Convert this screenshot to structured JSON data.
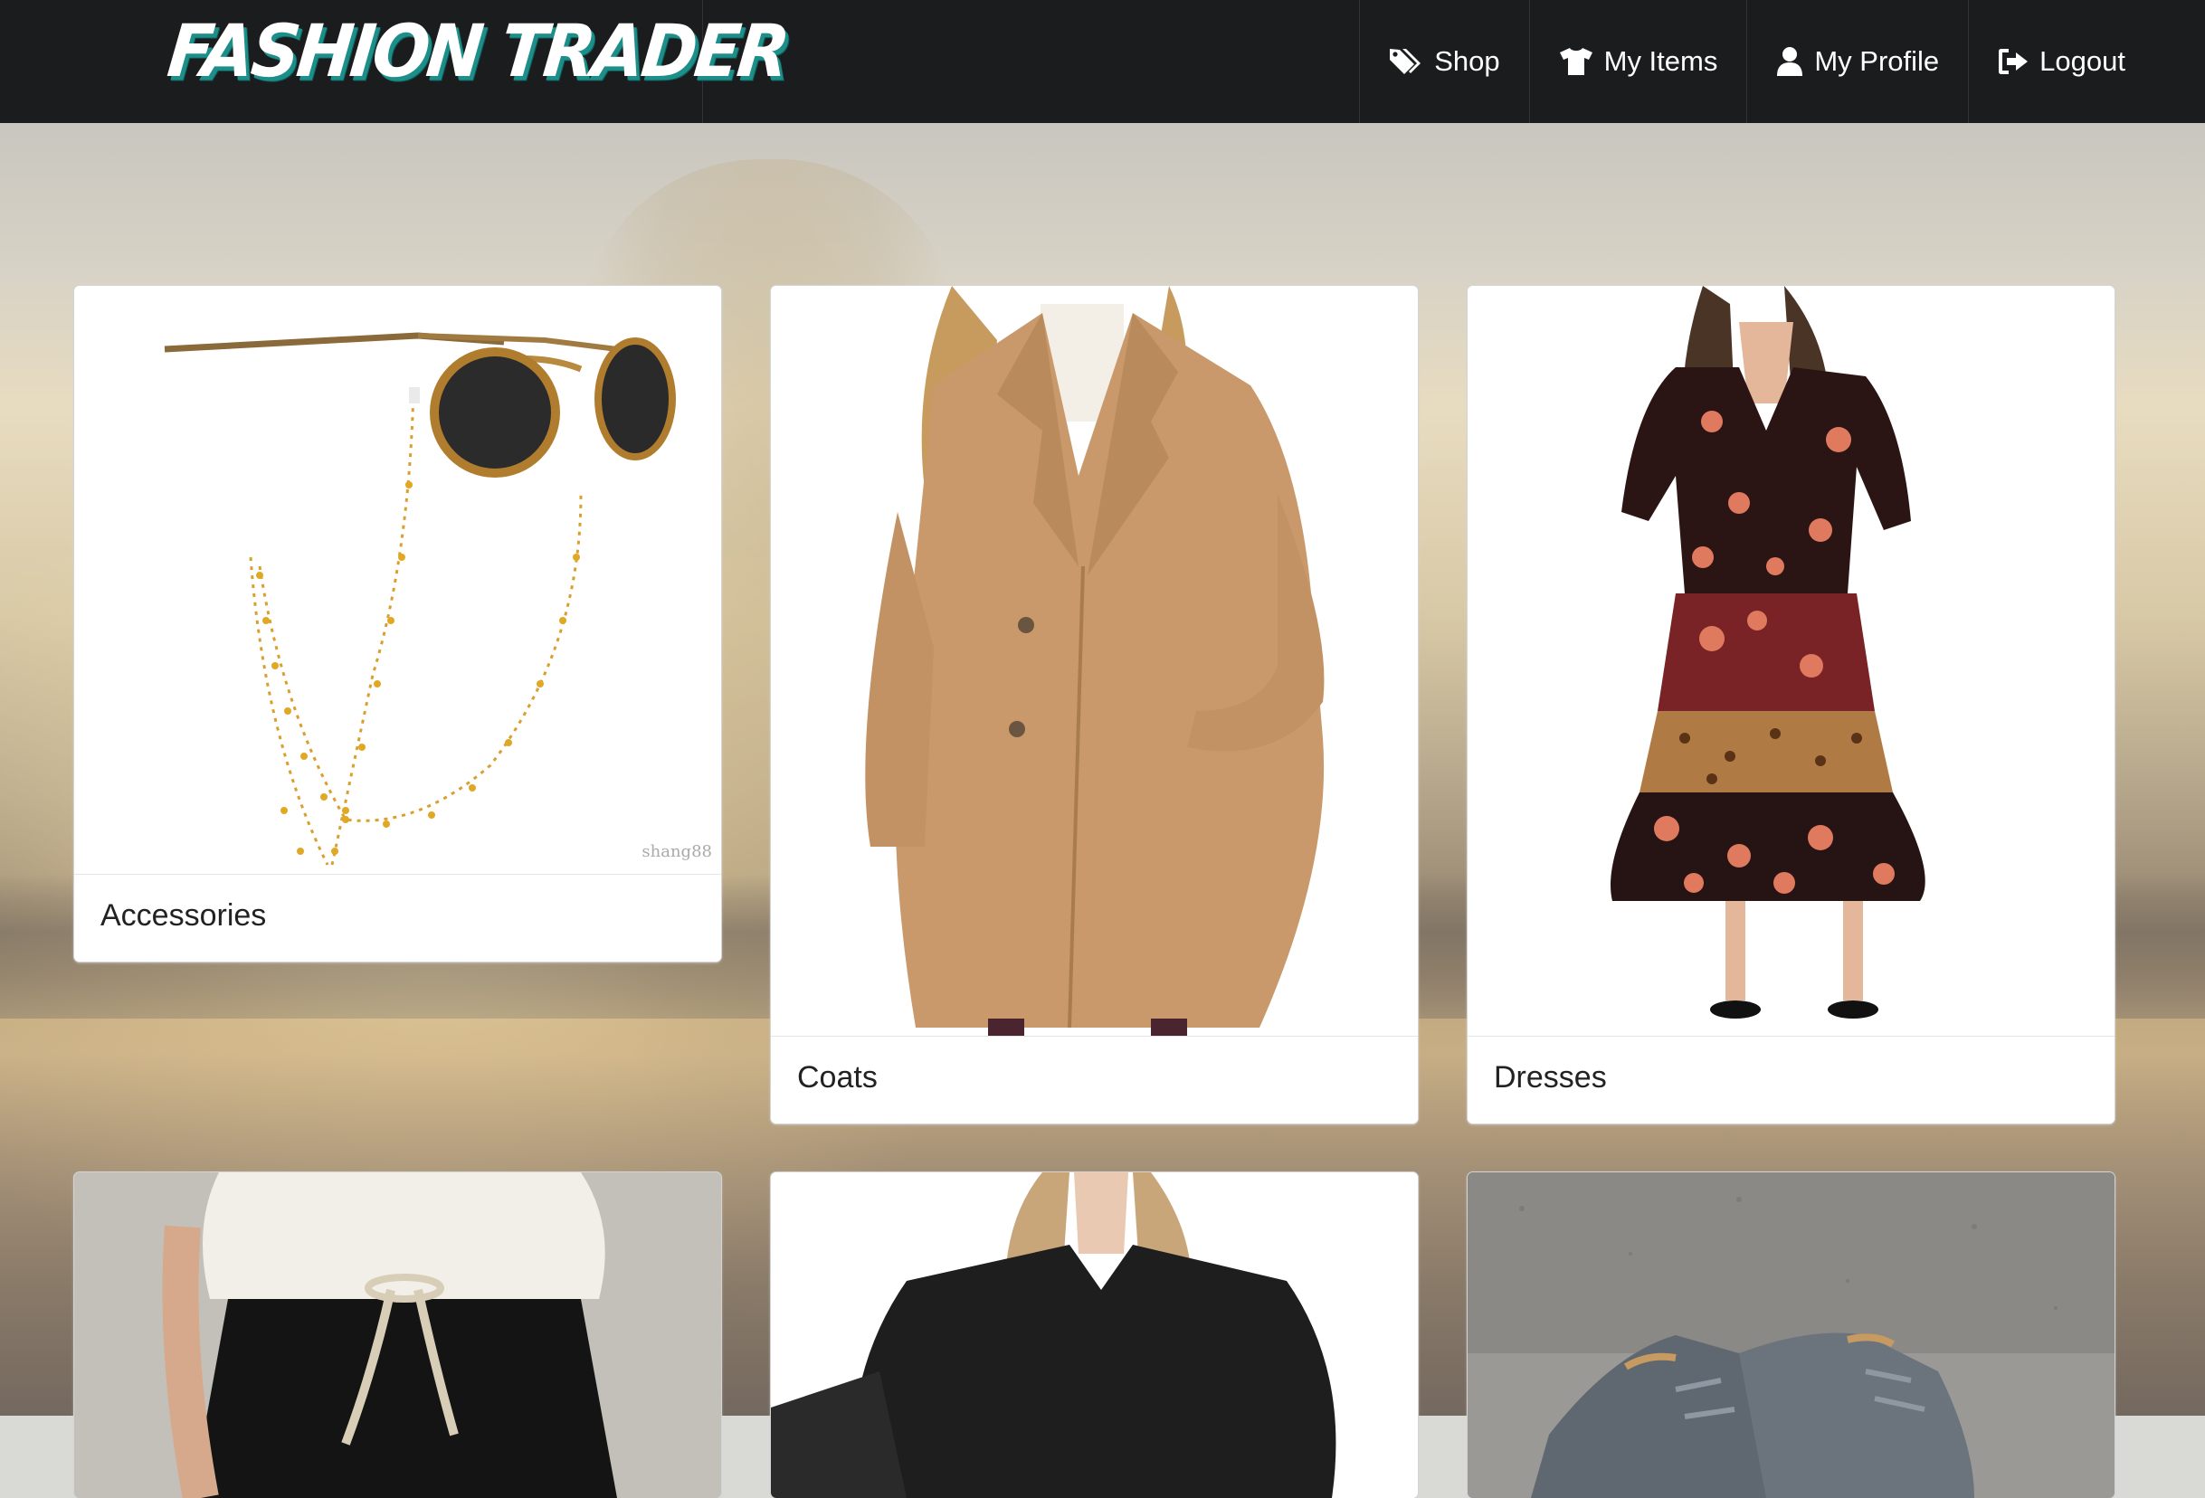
{
  "app": {
    "brand": "FASHION TRADER"
  },
  "nav": {
    "items": [
      {
        "label": "Shop",
        "icon": "tags-icon"
      },
      {
        "label": "My Items",
        "icon": "shirt-icon"
      },
      {
        "label": "My Profile",
        "icon": "user-icon"
      },
      {
        "label": "Logout",
        "icon": "sign-out-icon"
      }
    ]
  },
  "categories": [
    {
      "label": "Accessories",
      "image": "sunglasses-with-chain"
    },
    {
      "label": "Coats",
      "image": "camel-coat"
    },
    {
      "label": "Dresses",
      "image": "floral-dress"
    },
    {
      "label": "",
      "image": "joggers-and-sweatshirt"
    },
    {
      "label": "",
      "image": "black-blouse"
    },
    {
      "label": "",
      "image": "grey-sneakers"
    }
  ],
  "watermark": "shang88",
  "colors": {
    "navbar": "#1b1c1d",
    "brand_shadow": "#1d8f8a",
    "card": "#ffffff"
  }
}
